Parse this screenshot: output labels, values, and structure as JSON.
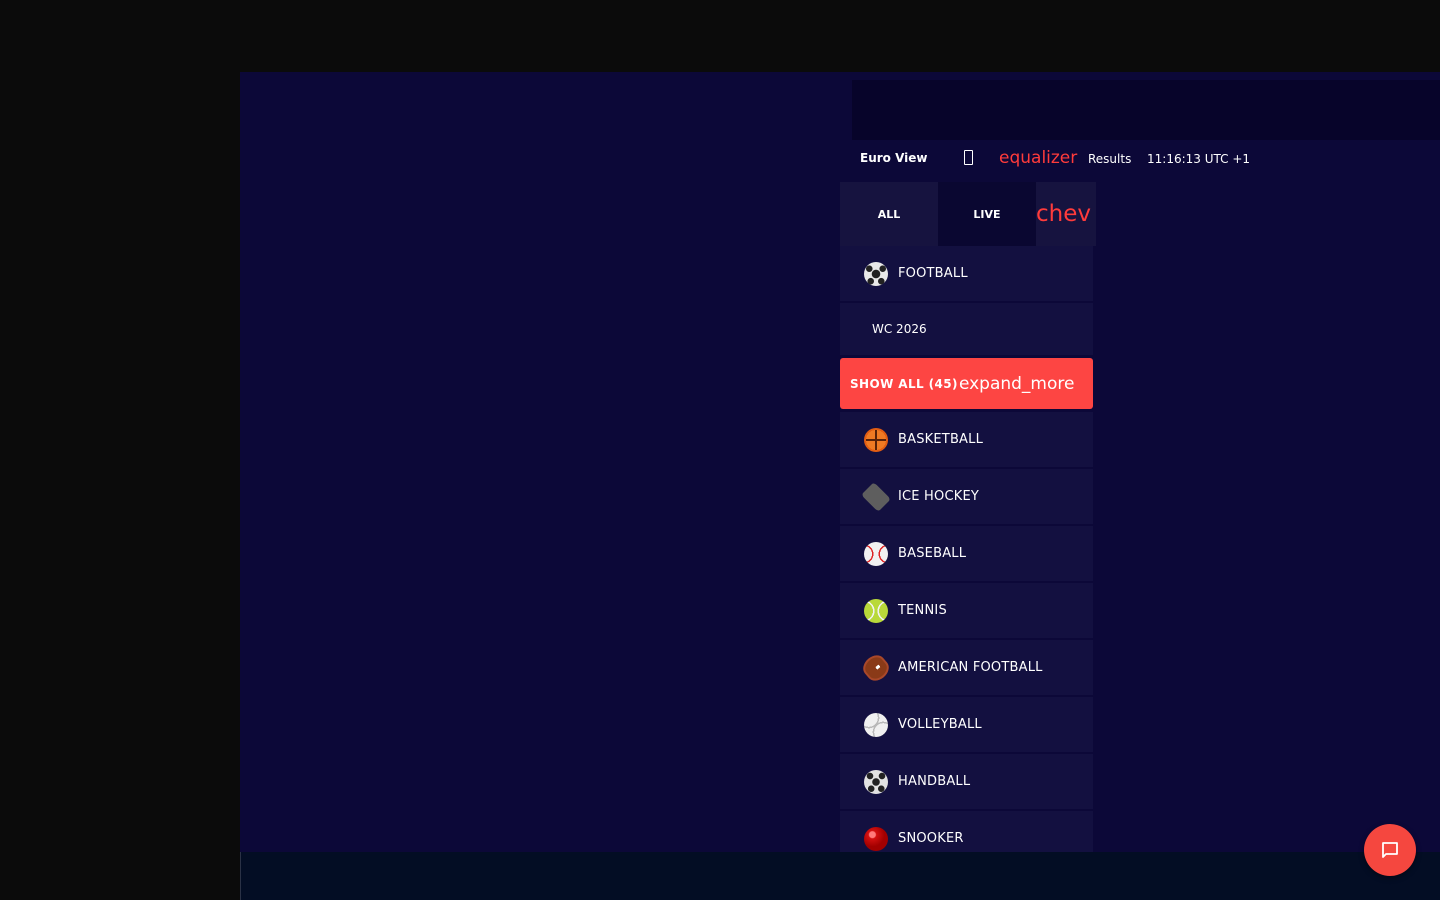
{
  "header": {
    "euro_view_glyph": "",
    "euro_view_label": "Euro View",
    "equalizer_label": "equalizer",
    "results_label": "Results",
    "clock": "11:16:13 UTC +1"
  },
  "tabs": [
    {
      "label": "ALL"
    },
    {
      "label": "LIVE"
    },
    {
      "label": "chev"
    }
  ],
  "sports": [
    {
      "label": "FOOTBALL",
      "icon": "football-icon"
    },
    {
      "label": "BASKETBALL",
      "icon": "basketball-icon"
    },
    {
      "label": "ICE HOCKEY",
      "icon": "ice-hockey-icon"
    },
    {
      "label": "BASEBALL",
      "icon": "baseball-icon"
    },
    {
      "label": "TENNIS",
      "icon": "tennis-icon"
    },
    {
      "label": "AMERICAN FOOTBALL",
      "icon": "american-football-icon"
    },
    {
      "label": "VOLLEYBALL",
      "icon": "volleyball-icon"
    },
    {
      "label": "HANDBALL",
      "icon": "handball-icon"
    },
    {
      "label": "SNOOKER",
      "icon": "snooker-icon"
    }
  ],
  "football_sub": {
    "label": "WC 2026"
  },
  "show_all": {
    "label": "SHOW ALL (45)",
    "icon_text": "expand_more"
  },
  "colors": {
    "accent": "#fd4543",
    "background": "#0c0838",
    "panel": "#131040"
  }
}
